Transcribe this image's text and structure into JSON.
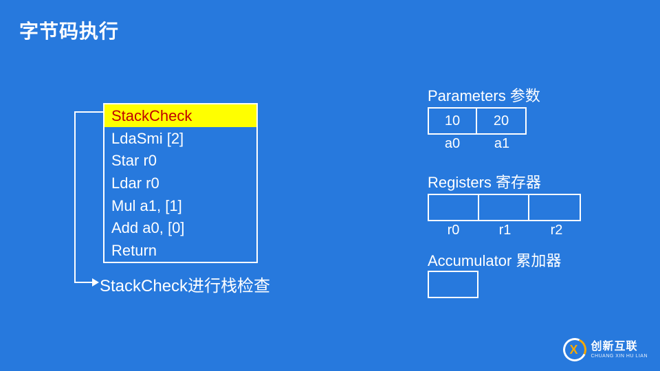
{
  "title": "字节码执行",
  "bytecode": {
    "current_index": 0,
    "lines": [
      "StackCheck",
      "LdaSmi [2]",
      "Star r0",
      "Ldar r0",
      "Mul a1, [1]",
      "Add a0, [0]",
      "Return"
    ]
  },
  "annotation": "StackCheck进行栈检查",
  "parameters": {
    "label": "Parameters 参数",
    "cells": [
      "10",
      "20"
    ],
    "names": [
      "a0",
      "a1"
    ]
  },
  "registers": {
    "label": "Registers 寄存器",
    "cells": [
      "",
      "",
      ""
    ],
    "names": [
      "r0",
      "r1",
      "r2"
    ]
  },
  "accumulator": {
    "label": "Accumulator 累加器",
    "cells": [
      ""
    ]
  },
  "logo": {
    "brand": "创新互联",
    "sub": "CHUANG XIN HU LIAN"
  }
}
